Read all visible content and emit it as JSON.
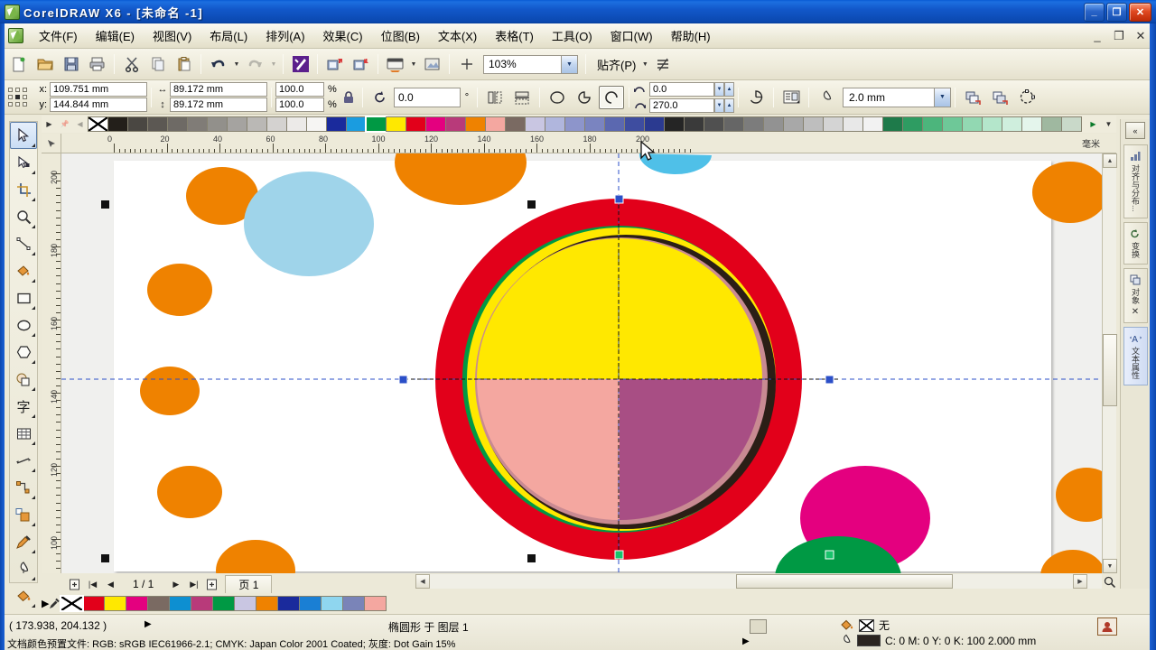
{
  "window": {
    "title": "CorelDRAW X6 - [未命名 -1]",
    "minimize": "_",
    "maximize": "❐",
    "close": "✕"
  },
  "menubar": {
    "items": [
      {
        "label": "文件(F)",
        "name": "menu-file"
      },
      {
        "label": "编辑(E)",
        "name": "menu-edit"
      },
      {
        "label": "视图(V)",
        "name": "menu-view"
      },
      {
        "label": "布局(L)",
        "name": "menu-layout"
      },
      {
        "label": "排列(A)",
        "name": "menu-arrange"
      },
      {
        "label": "效果(C)",
        "name": "menu-effects"
      },
      {
        "label": "位图(B)",
        "name": "menu-bitmaps"
      },
      {
        "label": "文本(X)",
        "name": "menu-text"
      },
      {
        "label": "表格(T)",
        "name": "menu-table"
      },
      {
        "label": "工具(O)",
        "name": "menu-tools"
      },
      {
        "label": "窗口(W)",
        "name": "menu-window"
      },
      {
        "label": "帮助(H)",
        "name": "menu-help"
      }
    ],
    "doc_minimize": "_",
    "doc_restore": "❐",
    "doc_close": "✕"
  },
  "toolbar": {
    "zoom_level": "103%",
    "snap_label": "贴齐(P)",
    "buttons": [
      {
        "name": "new-document-button",
        "title": "新建"
      },
      {
        "name": "open-document-button",
        "title": "打开"
      },
      {
        "name": "save-document-button",
        "title": "保存"
      },
      {
        "name": "print-button",
        "title": "打印"
      },
      {
        "name": "cut-button",
        "title": "剪切"
      },
      {
        "name": "copy-button",
        "title": "复制"
      },
      {
        "name": "paste-button",
        "title": "粘贴"
      },
      {
        "name": "undo-button",
        "title": "撤销"
      },
      {
        "name": "redo-button",
        "title": "重做"
      },
      {
        "name": "import-button",
        "title": "导入"
      },
      {
        "name": "export-button",
        "title": "导出"
      },
      {
        "name": "publish-pdf-button",
        "title": "发布为PDF"
      },
      {
        "name": "application-launcher-button",
        "title": "应用程序启动器"
      },
      {
        "name": "corel-connect-button",
        "title": "Corel CONNECT"
      }
    ]
  },
  "propertybar": {
    "x_label": "x:",
    "y_label": "y:",
    "x_value": "109.751 mm",
    "y_value": "144.844 mm",
    "width_value": "89.172 mm",
    "height_value": "89.172 mm",
    "scale_x": "100.0",
    "scale_y": "100.0",
    "percent_symbol": "%",
    "rotation_value": "0.0",
    "rotation_unit": "°",
    "start_angle": "0.0",
    "end_angle": "270.0",
    "outline_width": "2.0 mm",
    "shape_modes": [
      {
        "name": "ellipse-mode-button",
        "label": "椭圆形",
        "active": false
      },
      {
        "name": "pie-mode-button",
        "label": "饼形",
        "active": false
      },
      {
        "name": "arc-mode-button",
        "label": "弧",
        "active": true
      }
    ]
  },
  "rulers": {
    "unit_label": "毫米",
    "h_ticks": [
      "0",
      "20",
      "40",
      "60",
      "80",
      "100",
      "120",
      "140",
      "160",
      "180",
      "200"
    ],
    "v_ticks": [
      "200",
      "180",
      "160",
      "140",
      "120",
      "100"
    ]
  },
  "toolbox": {
    "tools": [
      {
        "name": "pick-tool",
        "label": "选择工具",
        "selected": true
      },
      {
        "name": "shape-tool",
        "label": "形状工具",
        "selected": false
      },
      {
        "name": "crop-tool",
        "label": "裁剪工具",
        "selected": false
      },
      {
        "name": "zoom-tool",
        "label": "缩放工具",
        "selected": false
      },
      {
        "name": "freehand-tool",
        "label": "手绘工具",
        "selected": false
      },
      {
        "name": "smart-fill-tool",
        "label": "智能填充",
        "selected": false
      },
      {
        "name": "rectangle-tool",
        "label": "矩形工具",
        "selected": false
      },
      {
        "name": "ellipse-tool",
        "label": "椭圆形工具",
        "selected": false
      },
      {
        "name": "polygon-tool",
        "label": "多边形工具",
        "selected": false
      },
      {
        "name": "basic-shapes-tool",
        "label": "基本形状",
        "selected": false
      },
      {
        "name": "text-tool",
        "label": "文本工具",
        "selected": false
      },
      {
        "name": "table-tool",
        "label": "表格工具",
        "selected": false
      },
      {
        "name": "dimension-tool",
        "label": "度量工具",
        "selected": false
      },
      {
        "name": "connector-tool",
        "label": "连接器工具",
        "selected": false
      },
      {
        "name": "blend-tool",
        "label": "调和工具",
        "selected": false
      },
      {
        "name": "color-eyedropper-tool",
        "label": "颜色滴管",
        "selected": false
      },
      {
        "name": "outline-tool",
        "label": "轮廓笔工具",
        "selected": false
      },
      {
        "name": "fill-tool",
        "label": "填充工具",
        "selected": false
      }
    ]
  },
  "palette": {
    "top_colors": [
      "none",
      "#231f1a",
      "#4a4742",
      "#5c5853",
      "#6e6a65",
      "#807c77",
      "#92908b",
      "#a5a3a0",
      "#bab8b5",
      "#d4d2d0",
      "#eceae8",
      "#f6f5f3",
      "#1a2a9c",
      "#1a9ce0",
      "#009944",
      "#ffe800",
      "#e2001a",
      "#e4007f",
      "#b83a7a",
      "#ef8200",
      "#f4a7a0",
      "#7a6a62",
      "#c9c6e2",
      "#b0b6dd",
      "#8d95cb",
      "#7a84c0",
      "#5b68b0",
      "#3e4da0",
      "#2b3a90",
      "#252525",
      "#3a3a3a",
      "#505050",
      "#666666",
      "#7c7c7c",
      "#929292",
      "#a8a8a8",
      "#bebebe",
      "#d4d4d4",
      "#e8e8e8",
      "#f2f2f2",
      "#1e7a4a",
      "#2e9c62",
      "#4cb57c",
      "#6ec898",
      "#92d8b2",
      "#b4e6cb",
      "#cfeedd",
      "#e4f5ec",
      "#9fb8a0",
      "#c9d9c9"
    ],
    "bottom_colors": [
      "none",
      "#e2001a",
      "#ffe800",
      "#e4007f",
      "#7a6a62",
      "#0d8fd1",
      "#b83a7a",
      "#009944",
      "#c9c6e2",
      "#ef8200",
      "#1a2a9c",
      "#1a7fd4",
      "#8fd6ef",
      "#7a84b8",
      "#f4a7a0"
    ],
    "selected_index": 14
  },
  "canvas": {
    "artwork_title": "椭圆形",
    "shapes": {
      "ring_outer": "#e2001a",
      "ring_inner_dark": "#2b1e16",
      "quad_top": "#ffe800",
      "quad_bottom_left": "#f4a7a0",
      "quad_bottom_right": "#a84e84",
      "green_arc": "#009944",
      "deco_orange": "#ef8200",
      "deco_lightblue": "#9fd4ea",
      "deco_magenta": "#e4007f",
      "deco_green": "#009944",
      "page_background": "#ffffff",
      "desk_background": "#f0f0ee"
    }
  },
  "pagenav": {
    "first_label": "|◀",
    "prev_label": "◀",
    "page_count": "1 / 1",
    "next_label": "▶",
    "last_label": "▶|",
    "add_left_label": "⊞",
    "add_right_label": "⊞",
    "tab_label": "页 1"
  },
  "statusbar": {
    "coordinates": "( 173.938, 204.132 )",
    "coord_arrow": "▶",
    "object_info": "椭圆形 于 图层 1",
    "color_profile": "文档颜色预置文件: RGB: sRGB IEC61966-2.1; CMYK: Japan Color 2001 Coated; 灰度: Dot Gain 15%",
    "profile_arrow": "▶",
    "fill_label": "无",
    "outline_value": "C: 0 M: 0 Y: 0 K: 100  2.000 mm",
    "outline_color": "#2b2420"
  },
  "docker": {
    "collapse_label": "«",
    "tabs": [
      {
        "name": "docker-tab-align",
        "label": "对齐与分布...",
        "active": false
      },
      {
        "name": "docker-tab-transform",
        "label": "变换",
        "active": false
      },
      {
        "name": "docker-tab-object",
        "label": "对象",
        "active": false
      },
      {
        "name": "docker-tab-text-properties",
        "label": "文本属性",
        "active": true
      }
    ]
  }
}
